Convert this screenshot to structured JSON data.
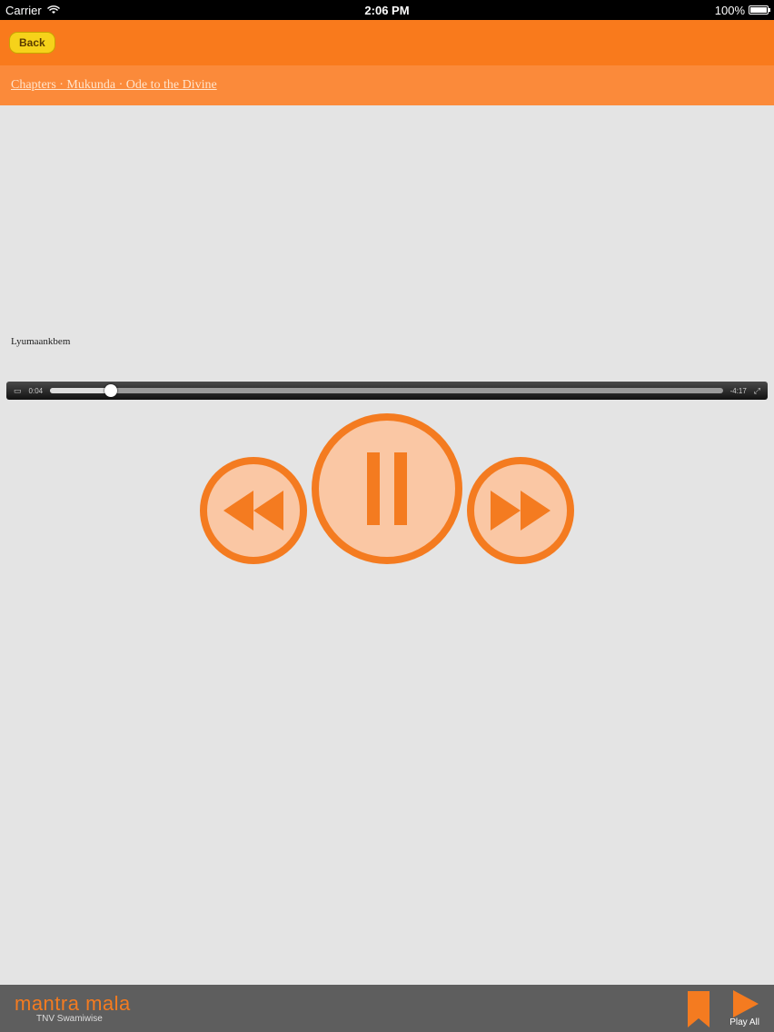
{
  "status_bar": {
    "carrier": "Carrier",
    "time": "2:06 PM",
    "battery": "100%"
  },
  "nav": {
    "back_label": "Back",
    "items": [
      "",
      "",
      "",
      "",
      "",
      "",
      "",
      "",
      ""
    ]
  },
  "breadcrumb": {
    "text": "Chapters · Mukunda · Ode to the Divine"
  },
  "track": {
    "label": "Lyumaankbem",
    "progress": 0.09
  },
  "player": {
    "elapsed": "0:04",
    "remaining": "-4:17"
  },
  "colors": {
    "accent": "#f47b20",
    "nav_bg": "#f97a1c",
    "button_fill": "#fac7a4",
    "bottom_bg": "#5e5e5e"
  },
  "bottom": {
    "brand_name": "mantra mala",
    "brand_sub": "TNV Swamiwise",
    "play_all_label": "Play All"
  }
}
